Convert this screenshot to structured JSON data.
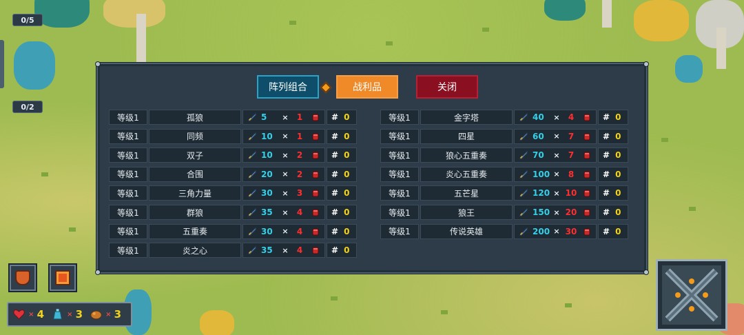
{
  "hud": {
    "counter_top": "0/5",
    "counter_mid": "0/2"
  },
  "resources": {
    "hearts": "4",
    "potions": "3",
    "food": "3",
    "x": "×"
  },
  "panel": {
    "tabs": {
      "formation": "阵列组合",
      "loot": "战利品",
      "close": "关闭"
    },
    "mul_symbol": "×",
    "hash_symbol": "#",
    "left_rows": [
      {
        "level": "等级1",
        "name": "孤狼",
        "attack": "5",
        "cost": "1",
        "count": "0"
      },
      {
        "level": "等级1",
        "name": "同频",
        "attack": "10",
        "cost": "1",
        "count": "0"
      },
      {
        "level": "等级1",
        "name": "双子",
        "attack": "10",
        "cost": "2",
        "count": "0"
      },
      {
        "level": "等级1",
        "name": "合围",
        "attack": "20",
        "cost": "2",
        "count": "0"
      },
      {
        "level": "等级1",
        "name": "三角力量",
        "attack": "30",
        "cost": "3",
        "count": "0"
      },
      {
        "level": "等级1",
        "name": "群狼",
        "attack": "35",
        "cost": "4",
        "count": "0"
      },
      {
        "level": "等级1",
        "name": "五重奏",
        "attack": "30",
        "cost": "4",
        "count": "0"
      },
      {
        "level": "等级1",
        "name": "炎之心",
        "attack": "35",
        "cost": "4",
        "count": "0"
      }
    ],
    "right_rows": [
      {
        "level": "等级1",
        "name": "金字塔",
        "attack": "40",
        "cost": "4",
        "count": "0"
      },
      {
        "level": "等级1",
        "name": "四星",
        "attack": "60",
        "cost": "7",
        "count": "0"
      },
      {
        "level": "等级1",
        "name": "狼心五重奏",
        "attack": "70",
        "cost": "7",
        "count": "0"
      },
      {
        "level": "等级1",
        "name": "炎心五重奏",
        "attack": "100",
        "cost": "8",
        "count": "0"
      },
      {
        "level": "等级1",
        "name": "五芒星",
        "attack": "120",
        "cost": "10",
        "count": "0"
      },
      {
        "level": "等级1",
        "name": "狼王",
        "attack": "150",
        "cost": "20",
        "count": "0"
      },
      {
        "level": "等级1",
        "name": "传说英雄",
        "attack": "200",
        "cost": "30",
        "count": "0"
      }
    ]
  },
  "colors": {
    "attack": "#35d0e8",
    "cost": "#ff2e2e",
    "count": "#f2d21a",
    "tab_formation": "#0e4e6a",
    "tab_loot": "#f08a28",
    "tab_close": "#8a0f20"
  }
}
